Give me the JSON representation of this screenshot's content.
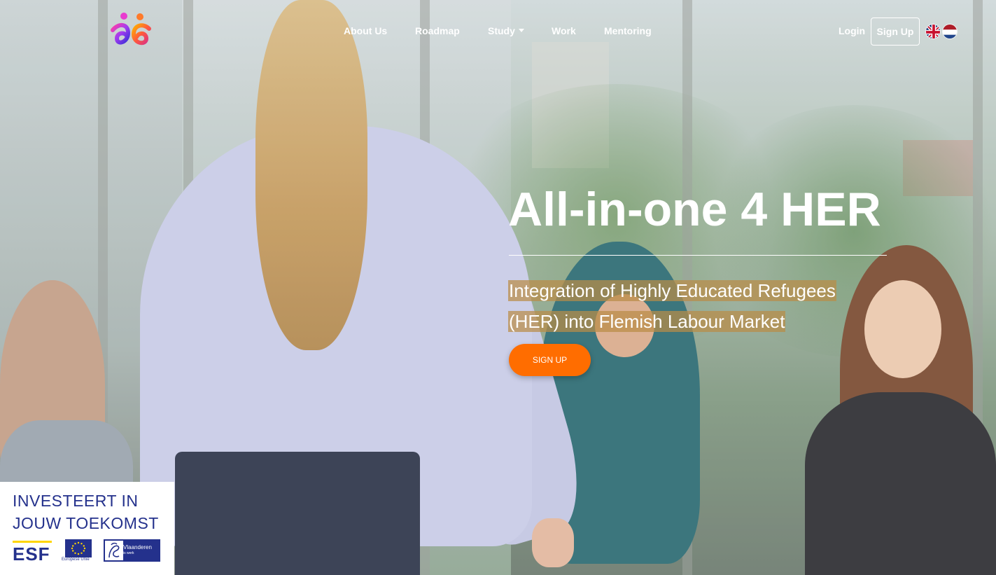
{
  "nav": {
    "items": [
      {
        "label": "About Us"
      },
      {
        "label": "Roadmap"
      },
      {
        "label": "Study",
        "has_dropdown": true
      },
      {
        "label": "Work"
      },
      {
        "label": "Mentoring"
      }
    ],
    "login": "Login",
    "signup": "Sign Up",
    "languages": [
      {
        "icon": "uk-flag-icon",
        "code": "en"
      },
      {
        "icon": "netherlands-flag-icon",
        "code": "nl"
      }
    ]
  },
  "hero": {
    "title": "All-in-one 4 HER",
    "subtitle_line1": "Integration of Highly Educated Refugees",
    "subtitle_line2": "(HER) into Flemish Labour Market",
    "cta": "SIGN UP"
  },
  "esf_badge": {
    "line1": "INVESTEERT IN",
    "line2": "JOUW TOEKOMST",
    "esf": "ESF",
    "eu_caption": "Europese Unie",
    "vlaanderen": "Vlaanderen",
    "vlaanderen_sub": "is werk"
  },
  "colors": {
    "accent": "#ff6d00",
    "highlight": "#ba8c46",
    "esf_blue": "#24318c"
  }
}
